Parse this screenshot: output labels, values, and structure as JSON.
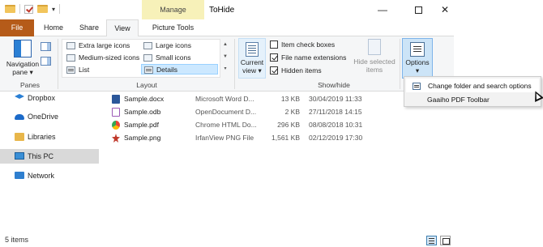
{
  "window": {
    "title": "ToHide",
    "contextual_tab_group": "Manage",
    "minimize_glyph": "—",
    "close_glyph": "✕"
  },
  "quick_access": {
    "dropdown_glyph": "▾"
  },
  "tabs": [
    {
      "label": "File"
    },
    {
      "label": "Home"
    },
    {
      "label": "Share"
    },
    {
      "label": "View"
    },
    {
      "label": "Picture Tools"
    }
  ],
  "ribbon": {
    "panes": {
      "navigation_pane_line1": "Navigation",
      "navigation_pane_line2": "pane ▾",
      "group_label": "Panes"
    },
    "layout": {
      "items": [
        {
          "label": "Extra large icons"
        },
        {
          "label": "Large icons"
        },
        {
          "label": "Medium-sized icons"
        },
        {
          "label": "Small icons"
        },
        {
          "label": "List"
        },
        {
          "label": "Details"
        }
      ],
      "selected": "Details",
      "group_label": "Layout"
    },
    "current_view": {
      "line1": "Current",
      "line2": "view ▾"
    },
    "show_hide": {
      "item_check_boxes": {
        "label": "Item check boxes",
        "checked": false
      },
      "file_name_extensions": {
        "label": "File name extensions",
        "checked": true
      },
      "hidden_items": {
        "label": "Hidden items",
        "checked": true
      },
      "hide_selected_line1": "Hide selected",
      "hide_selected_line2": "items",
      "group_label": "Show/hide"
    },
    "options": {
      "label": "Options",
      "arrow": "▾"
    }
  },
  "options_menu": {
    "items": [
      {
        "label": "Change folder and search options",
        "highlighted": true
      },
      {
        "label": "Gaaiho PDF Toolbar",
        "highlighted": false
      }
    ]
  },
  "navigation": {
    "items": [
      {
        "label": "Dropbox",
        "icon": "dropbox-icon",
        "selected": false
      },
      {
        "label": "OneDrive",
        "icon": "onedrive-icon",
        "selected": false
      },
      {
        "label": "Libraries",
        "icon": "libraries-icon",
        "selected": false
      },
      {
        "label": "This PC",
        "icon": "this-pc-icon",
        "selected": true
      },
      {
        "label": "Network",
        "icon": "network-icon",
        "selected": false
      }
    ]
  },
  "files": [
    {
      "name": "Sample.docx",
      "type": "Microsoft Word D...",
      "size": "13 KB",
      "modified": "30/04/2019 11:33",
      "icon": "word-doc-icon"
    },
    {
      "name": "Sample.odb",
      "type": "OpenDocument D...",
      "size": "2 KB",
      "modified": "27/11/2018 14:15",
      "icon": "odb-file-icon"
    },
    {
      "name": "Sample.pdf",
      "type": "Chrome HTML Do...",
      "size": "296 KB",
      "modified": "08/08/2018 10:31",
      "icon": "chrome-pdf-icon"
    },
    {
      "name": "Sample.png",
      "type": "IrfanView PNG File",
      "size": "1,561 KB",
      "modified": "02/12/2019 17:30",
      "icon": "irfanview-png-icon"
    }
  ],
  "status": {
    "item_count": "5 items"
  },
  "colors": {
    "file_tab": "#b55b19",
    "contextual_tab": "#f7f1b9",
    "selection": "#cce8ff",
    "options_active": "#cce4f7"
  }
}
